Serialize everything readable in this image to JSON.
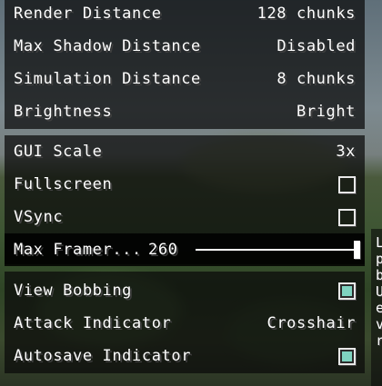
{
  "groups": [
    {
      "rows": [
        {
          "label": "Render Distance",
          "value": "128 chunks"
        },
        {
          "label": "Max Shadow Distance",
          "value": "Disabled"
        },
        {
          "label": "Simulation Distance",
          "value": "8 chunks"
        },
        {
          "label": "Brightness",
          "value": "Bright"
        }
      ]
    },
    {
      "rows": [
        {
          "label": "GUI Scale",
          "value": "3x"
        },
        {
          "label": "Fullscreen",
          "checked": false
        },
        {
          "label": "VSync",
          "checked": false
        }
      ],
      "slider": {
        "label": "Max Framer...",
        "value": "260",
        "fill_fraction": 1.0
      }
    },
    {
      "rows": [
        {
          "label": "View Bobbing",
          "checked": true
        },
        {
          "label": "Attack Indicator",
          "value": "Crosshair"
        },
        {
          "label": "Autosave Indicator",
          "checked": true
        }
      ]
    }
  ],
  "side_text": [
    "L",
    "p",
    "b",
    "U",
    "e",
    "v",
    "r"
  ]
}
